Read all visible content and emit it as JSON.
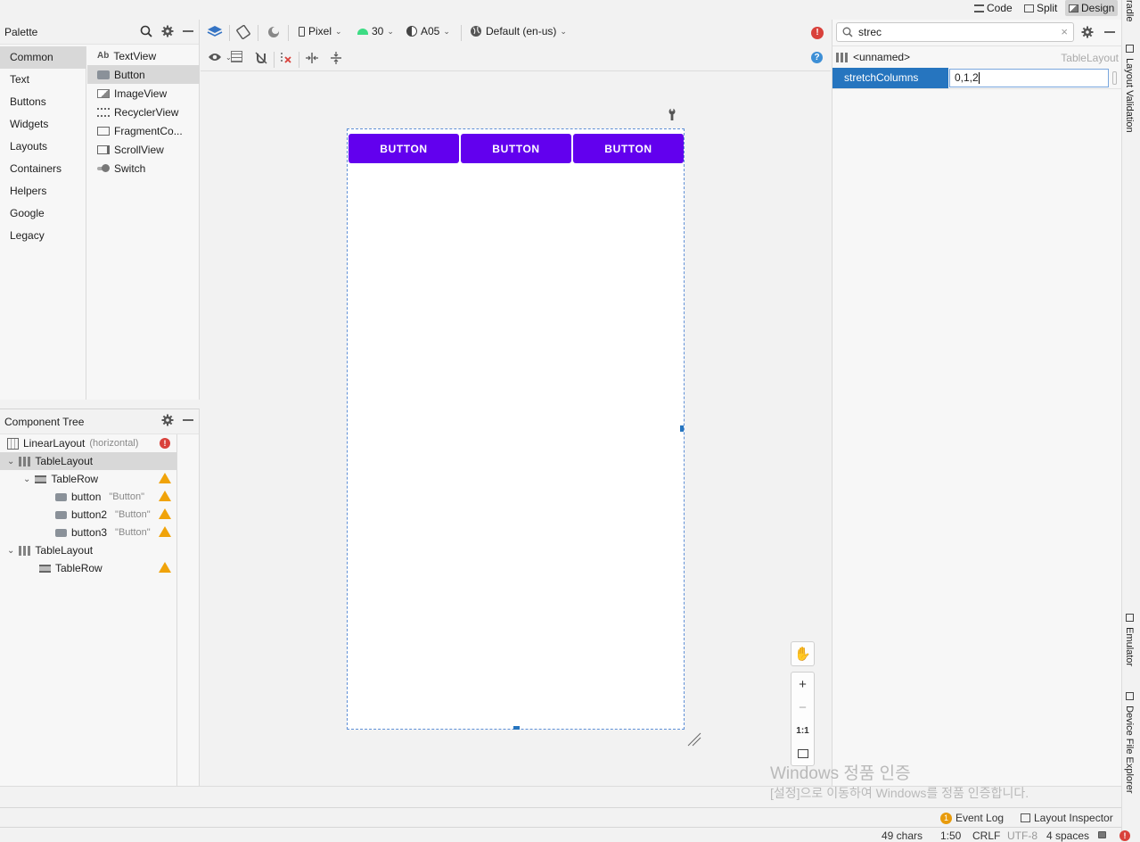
{
  "view_modes": {
    "code": "Code",
    "split": "Split",
    "design": "Design"
  },
  "right_tabs": {
    "gradle": "radle",
    "layout_validation": "Layout Validation",
    "emulator": "Emulator",
    "device_file_explorer": "Device File Explorer"
  },
  "palette": {
    "title": "Palette",
    "categories": [
      "Common",
      "Text",
      "Buttons",
      "Widgets",
      "Layouts",
      "Containers",
      "Helpers",
      "Google",
      "Legacy"
    ],
    "widgets": [
      "TextView",
      "Button",
      "ImageView",
      "RecyclerView",
      "FragmentCo...",
      "ScrollView",
      "Switch"
    ],
    "textview_prefix": "Ab"
  },
  "component_tree": {
    "title": "Component Tree",
    "nodes": [
      {
        "label": "LinearLayout",
        "hint": "(horizontal)"
      },
      {
        "label": "TableLayout",
        "hint": ""
      },
      {
        "label": "TableRow",
        "hint": ""
      },
      {
        "label": "button",
        "hint": "\"Button\""
      },
      {
        "label": "button2",
        "hint": "\"Button\""
      },
      {
        "label": "button3",
        "hint": "\"Button\""
      },
      {
        "label": "TableLayout",
        "hint": ""
      },
      {
        "label": "TableRow",
        "hint": ""
      }
    ]
  },
  "design_toolbar": {
    "device": "Pixel",
    "api": "30",
    "theme": "A05",
    "locale": "Default (en-us)"
  },
  "canvas": {
    "buttons": [
      "BUTTON",
      "BUTTON",
      "BUTTON"
    ],
    "zoom": {
      "plus": "+",
      "minus": "−",
      "one_to_one": "1:1"
    }
  },
  "attributes": {
    "search_value": "strec",
    "component_name": "<unnamed>",
    "component_type": "TableLayout",
    "attr_name": "stretchColumns",
    "attr_value": "0,1,2"
  },
  "watermark": {
    "line1": "Windows 정품 인증",
    "line2": "[설정]으로 이동하여 Windows를 정품 인증합니다."
  },
  "status": {
    "event_log_count": "1",
    "event_log": "Event Log",
    "layout_inspector": "Layout Inspector",
    "chars": "49 chars",
    "position": "1:50",
    "line_sep": "CRLF",
    "encoding": "UTF-8",
    "indent": "4 spaces"
  },
  "colors": {
    "accent": "#6200ee",
    "selection": "#2675bf",
    "warning": "#f0a30a",
    "error": "#d9413b"
  }
}
